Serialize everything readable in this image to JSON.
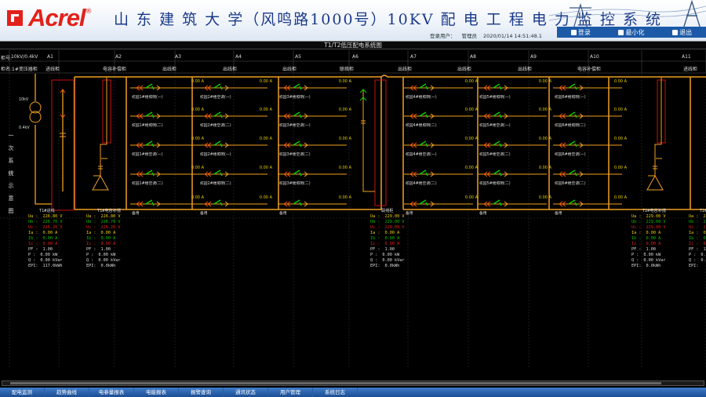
{
  "header": {
    "logo_text": "Acrel",
    "title": "山 东 建 筑 大 学（风鸣路1000号）10KV 配 电 工 程 电 力 监 控 系 统",
    "user_label": "登录用户：",
    "user_name": "管理员",
    "datetime": "2020/01/14  14:51:48.1",
    "buttons": [
      "登录",
      "最小化",
      "退出"
    ]
  },
  "window_title": "T1/T2低压配电系统图",
  "row_labels": {
    "cabinet_no": "柜号:",
    "voltage": "10kV/0.4kV",
    "cabinet_name": "柜名:"
  },
  "columns": [
    {
      "id": "A1",
      "name": "进线柜",
      "pre": "1#变压器柜"
    },
    {
      "id": "A2",
      "name": "电容补偿柜"
    },
    {
      "id": "A3",
      "name": "出线柜"
    },
    {
      "id": "A4",
      "name": "出线柜"
    },
    {
      "id": "A5",
      "name": "出线柜"
    },
    {
      "id": "A6",
      "name": "联络柜"
    },
    {
      "id": "A7",
      "name": "出线柜"
    },
    {
      "id": "A8",
      "name": "出线柜"
    },
    {
      "id": "A9",
      "name": "出线柜"
    },
    {
      "id": "A10",
      "name": "电容补偿柜"
    },
    {
      "id": "A11",
      "name": "进线柜"
    }
  ],
  "transformer_labels": {
    "hv": "10kV",
    "lv": "0.4kV"
  },
  "side_label": [
    "一",
    "次",
    "系",
    "统",
    "示",
    "意",
    "图"
  ],
  "feeder_reading": "0.00  A",
  "feeders": [
    [
      "校园1#楼照明(一)",
      "校园1#楼照明(二)",
      "校园1#楼空调(一)",
      "校园1#楼空调(二)",
      "备用"
    ],
    [
      "校园2#楼空调(一)",
      "校园2#楼空调(二)",
      "校园2#楼照明(一)",
      "校园2#楼照明(二)",
      "备用"
    ],
    [
      "校园3#楼照明(一)",
      "校园3#楼空调(一)",
      "校园3#楼空调(二)",
      "校园3#楼照明(二)",
      "备用"
    ],
    [
      "校园4#楼照明(一)",
      "校园4#楼照明(二)",
      "校园4#楼空调(一)",
      "校园4#楼空调(二)",
      "备用"
    ],
    [
      "校园5#楼照明(一)",
      "校园5#楼空调(一)",
      "校园5#楼空调(二)",
      "校园5#楼照明(二)",
      "备用"
    ],
    [
      "校园6#楼照明(一)",
      "校园6#楼照明(二)",
      "校园6#楼空调(一)",
      "校园6#楼空调(二)",
      "备用"
    ]
  ],
  "measurements": [
    {
      "title": "T1#进线",
      "rows": [
        [
          "Ua :",
          "226.80 V"
        ],
        [
          "Ub :",
          "226.70 V"
        ],
        [
          "Uc :",
          "226.20 V"
        ],
        [
          "Ia :",
          "0.00 A"
        ],
        [
          "Ib :",
          "0.00 A"
        ],
        [
          "Ic :",
          "0.00 A"
        ],
        [
          "PF :",
          "1.00"
        ],
        [
          "P :",
          "0.00 kW"
        ],
        [
          "Q :",
          "0.00 kVar"
        ],
        [
          "EPI:",
          "117.0kWh"
        ]
      ]
    },
    {
      "title": "T1#电容补偿",
      "rows": [
        [
          "Ua :",
          "226.80 V"
        ],
        [
          "Ub :",
          "226.70 V"
        ],
        [
          "Uc :",
          "226.20 V"
        ],
        [
          "Ia :",
          "0.00 A"
        ],
        [
          "Ib :",
          "0.00 A"
        ],
        [
          "Ic :",
          "0.00 A"
        ],
        [
          "PF :",
          "1.00"
        ],
        [
          "P :",
          "0.00 kW"
        ],
        [
          "Q :",
          "0.00 kVar"
        ],
        [
          "EPI:",
          "0.0kWh"
        ]
      ]
    },
    {
      "title": "联络柜",
      "rows": [
        [
          "Ua :",
          "229.00 V"
        ],
        [
          "Ub :",
          "229.00 V"
        ],
        [
          "Uc :",
          "229.00 V"
        ],
        [
          "Ia :",
          "0.00 A"
        ],
        [
          "Ib :",
          "0.00 A"
        ],
        [
          "Ic :",
          "0.00 A"
        ],
        [
          "PF :",
          "1.00"
        ],
        [
          "P :",
          "0.00 kW"
        ],
        [
          "Q :",
          "0.00 kVar"
        ],
        [
          "EPI:",
          "0.0kWh"
        ]
      ]
    },
    {
      "title": "T2#电容补偿",
      "rows": [
        [
          "Ua :",
          "229.00 V"
        ],
        [
          "Ub :",
          "229.00 V"
        ],
        [
          "Uc :",
          "229.00 V"
        ],
        [
          "Ia :",
          "0.00 A"
        ],
        [
          "Ib :",
          "0.00 A"
        ],
        [
          "Ic :",
          "0.00 A"
        ],
        [
          "PF :",
          "1.00"
        ],
        [
          "P :",
          "0.00 kW"
        ],
        [
          "Q :",
          "0.00 kVar"
        ],
        [
          "EPI:",
          "0.0kWh"
        ]
      ]
    },
    {
      "title": "T2#进线",
      "rows": [
        [
          "Ua :",
          "229"
        ],
        [
          "Ub :",
          "229"
        ],
        [
          "Uc :",
          "229"
        ],
        [
          "Ia :",
          "0."
        ],
        [
          "Ib :",
          "0."
        ],
        [
          "Ic :",
          "0."
        ],
        [
          "PF :",
          "1"
        ],
        [
          "P :",
          "0."
        ],
        [
          "Q :",
          "0."
        ],
        [
          "EPI:",
          ""
        ]
      ]
    }
  ],
  "nav": [
    "配电监测",
    "趋势曲线",
    "电参量报表",
    "电能报表",
    "报警查询",
    "通讯状态",
    "用户管理",
    "系统日志"
  ],
  "colors": {
    "bus": "#f0a020",
    "arrow": "#ff5500",
    "breaker": "#00d000",
    "cabinet": "#cc1111",
    "nav": "#2a64b4"
  }
}
